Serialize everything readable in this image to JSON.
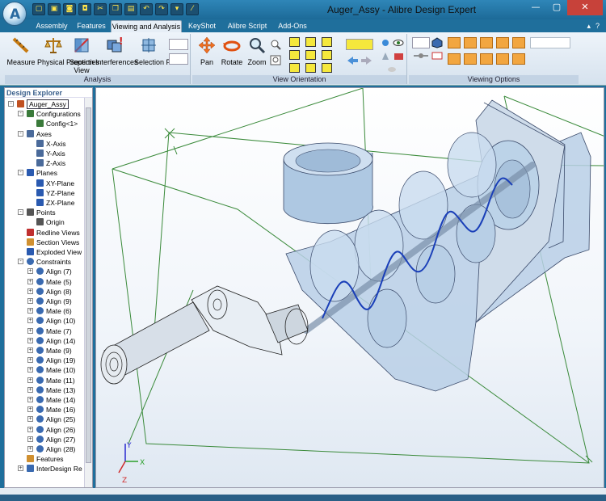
{
  "window": {
    "title": "Auger_Assy - Alibre Design Expert"
  },
  "icons": {
    "app": "alibre-logo-icon"
  },
  "quick_access": [
    "new-icon",
    "open-icon",
    "save-icon",
    "save-all-icon",
    "cut-icon",
    "copy-icon",
    "paste-icon",
    "undo-icon",
    "redo-icon",
    "options-icon",
    "measure-icon"
  ],
  "tabs": [
    {
      "label": "Assembly",
      "active": false
    },
    {
      "label": "Features",
      "active": false
    },
    {
      "label": "Viewing and Analysis",
      "active": true
    },
    {
      "label": "KeyShot",
      "active": false
    },
    {
      "label": "Alibre Script",
      "active": false
    },
    {
      "label": "Add-Ons",
      "active": false
    }
  ],
  "ribbon_help": "?",
  "groups": {
    "analysis": {
      "label": "Analysis",
      "buttons": [
        "Measure",
        "Physical Properties",
        "Section View",
        "Interferences",
        "Selection Filters"
      ]
    },
    "view_orientation": {
      "label": "View Orientation",
      "buttons": [
        "Pan",
        "Rotate",
        "Zoom"
      ]
    },
    "viewing_options": {
      "label": "Viewing Options"
    }
  },
  "explorer": {
    "title": "Design Explorer",
    "nodes": [
      {
        "label": "Auger_Assy",
        "level": 0,
        "expander": "-",
        "icon": "assembly-icon"
      },
      {
        "label": "Configurations",
        "level": 1,
        "expander": "-",
        "icon": "configurations-icon"
      },
      {
        "label": "Config<1>",
        "level": 2,
        "expander": "",
        "icon": "config-icon"
      },
      {
        "label": "Axes",
        "level": 1,
        "expander": "-",
        "icon": "axes-icon"
      },
      {
        "label": "X-Axis",
        "level": 2,
        "expander": "",
        "icon": "axis-icon"
      },
      {
        "label": "Y-Axis",
        "level": 2,
        "expander": "",
        "icon": "axis-icon"
      },
      {
        "label": "Z-Axis",
        "level": 2,
        "expander": "",
        "icon": "axis-icon"
      },
      {
        "label": "Planes",
        "level": 1,
        "expander": "-",
        "icon": "planes-icon"
      },
      {
        "label": "XY-Plane",
        "level": 2,
        "expander": "",
        "icon": "plane-icon"
      },
      {
        "label": "YZ-Plane",
        "level": 2,
        "expander": "",
        "icon": "plane-icon"
      },
      {
        "label": "ZX-Plane",
        "level": 2,
        "expander": "",
        "icon": "plane-icon"
      },
      {
        "label": "Points",
        "level": 1,
        "expander": "-",
        "icon": "points-icon"
      },
      {
        "label": "Origin",
        "level": 2,
        "expander": "",
        "icon": "origin-icon"
      },
      {
        "label": "Redline Views",
        "level": 1,
        "expander": "",
        "icon": "redline-icon"
      },
      {
        "label": "Section Views",
        "level": 1,
        "expander": "",
        "icon": "section-icon"
      },
      {
        "label": "Exploded View",
        "level": 1,
        "expander": "",
        "icon": "exploded-icon"
      },
      {
        "label": "Constraints",
        "level": 1,
        "expander": "-",
        "icon": "constraints-icon"
      },
      {
        "label": "Align (7)",
        "level": 2,
        "expander": "+",
        "icon": "constraint-icon"
      },
      {
        "label": "Mate (5)",
        "level": 2,
        "expander": "+",
        "icon": "constraint-icon"
      },
      {
        "label": "Align (8)",
        "level": 2,
        "expander": "+",
        "icon": "constraint-icon"
      },
      {
        "label": "Align (9)",
        "level": 2,
        "expander": "+",
        "icon": "constraint-icon"
      },
      {
        "label": "Mate (6)",
        "level": 2,
        "expander": "+",
        "icon": "constraint-icon"
      },
      {
        "label": "Align (10)",
        "level": 2,
        "expander": "+",
        "icon": "constraint-icon"
      },
      {
        "label": "Mate (7)",
        "level": 2,
        "expander": "+",
        "icon": "constraint-icon"
      },
      {
        "label": "Align (14)",
        "level": 2,
        "expander": "+",
        "icon": "constraint-icon"
      },
      {
        "label": "Mate (9)",
        "level": 2,
        "expander": "+",
        "icon": "constraint-icon"
      },
      {
        "label": "Align (19)",
        "level": 2,
        "expander": "+",
        "icon": "constraint-icon"
      },
      {
        "label": "Mate (10)",
        "level": 2,
        "expander": "+",
        "icon": "constraint-icon"
      },
      {
        "label": "Mate (11)",
        "level": 2,
        "expander": "+",
        "icon": "constraint-icon"
      },
      {
        "label": "Mate (13)",
        "level": 2,
        "expander": "+",
        "icon": "constraint-icon"
      },
      {
        "label": "Mate (14)",
        "level": 2,
        "expander": "+",
        "icon": "constraint-icon"
      },
      {
        "label": "Mate (16)",
        "level": 2,
        "expander": "+",
        "icon": "constraint-icon"
      },
      {
        "label": "Align (25)",
        "level": 2,
        "expander": "+",
        "icon": "constraint-icon"
      },
      {
        "label": "Align (26)",
        "level": 2,
        "expander": "+",
        "icon": "constraint-icon"
      },
      {
        "label": "Align (27)",
        "level": 2,
        "expander": "+",
        "icon": "constraint-icon"
      },
      {
        "label": "Align (28)",
        "level": 2,
        "expander": "+",
        "icon": "constraint-icon"
      },
      {
        "label": "Features",
        "level": 1,
        "expander": "",
        "icon": "features-icon"
      },
      {
        "label": "InterDesign Re",
        "level": 1,
        "expander": "+",
        "icon": "part-icon"
      }
    ]
  },
  "triad": {
    "x": "X",
    "y": "Y",
    "z": "Z"
  },
  "colors": {
    "titlebar": "#1f6f9c",
    "helix": "#1a3fb8",
    "grid": "#3a8a3a",
    "part": "#b9cfe6"
  }
}
